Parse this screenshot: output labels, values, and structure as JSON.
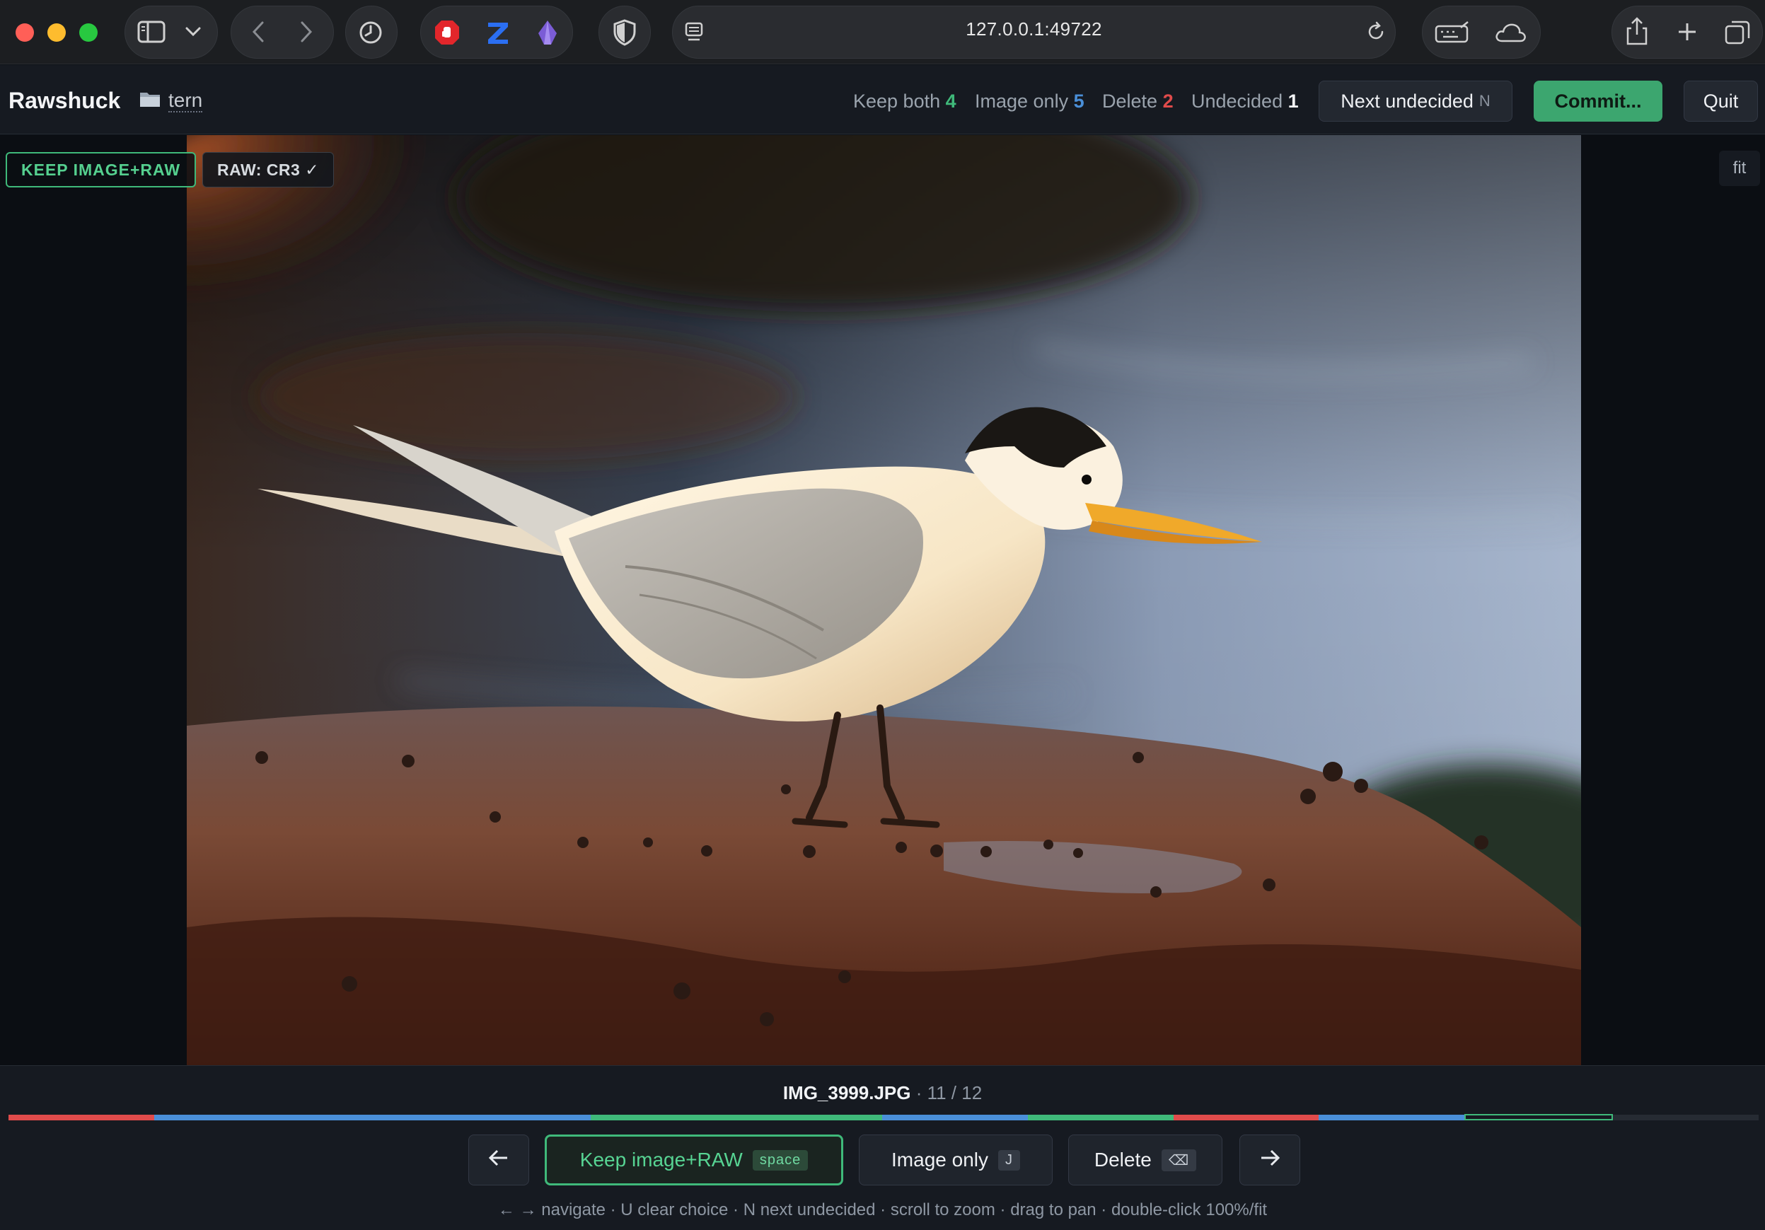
{
  "browser": {
    "url": "127.0.0.1:49722",
    "icons": [
      "sidebar-icon",
      "chevron-down-icon",
      "back-icon",
      "forward-icon",
      "history-icon",
      "stop-extension-icon",
      "z-extension-icon",
      "crystal-extension-icon",
      "shield-icon",
      "reader-icon",
      "reload-icon",
      "keyboard-icon",
      "cloud-icon",
      "share-icon",
      "new-tab-icon",
      "tabs-overview-icon"
    ]
  },
  "header": {
    "app_name": "Rawshuck",
    "folder": "tern",
    "stats": {
      "keep_both_label": "Keep both",
      "keep_both_count": "4",
      "image_only_label": "Image only",
      "image_only_count": "5",
      "delete_label": "Delete",
      "delete_count": "2",
      "undecided_label": "Undecided",
      "undecided_count": "1"
    },
    "next_undecided_label": "Next undecided",
    "next_undecided_key": "N",
    "commit_label": "Commit...",
    "quit_label": "Quit"
  },
  "viewer": {
    "decision_badge": "KEEP IMAGE+RAW",
    "raw_badge": "RAW: CR3 ✓",
    "zoom_label": "fit"
  },
  "footer": {
    "filename": "IMG_3999.JPG",
    "separator": " · ",
    "position": "11 / 12",
    "progress": [
      "delete",
      "image-only",
      "image-only",
      "image-only",
      "keep",
      "keep",
      "image-only",
      "keep",
      "delete",
      "image-only",
      "keep",
      "undecided"
    ],
    "current_index": 10,
    "colors": {
      "delete": "#e04b4b",
      "image-only": "#4a8fd8",
      "keep": "#3fb97a",
      "undecided": "#262b33"
    },
    "prev_icon": "arrow-left-icon",
    "next_icon": "arrow-right-icon",
    "keep_label": "Keep image+RAW",
    "keep_key": "space",
    "image_only_label": "Image only",
    "image_only_key": "J",
    "delete_label": "Delete",
    "delete_key": "⌫",
    "hint": "← → navigate · U clear choice · N next undecided · scroll to zoom · drag to pan · double-click 100%/fit"
  },
  "accent_colors": {
    "green": "#3fb97a",
    "blue": "#4a8fd8",
    "red": "#e04b4b"
  }
}
